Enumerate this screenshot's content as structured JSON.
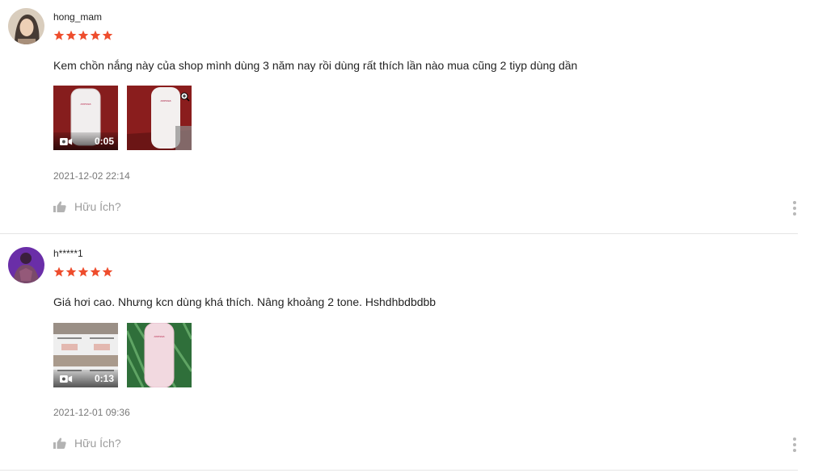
{
  "colors": {
    "star": "#ee4d2d",
    "text": "#222222",
    "muted": "#8a8a8a",
    "divider": "#e5e5e5"
  },
  "reviews": [
    {
      "author": "hong_mam",
      "rating": 5,
      "comment": "Kem chồn nắng này  của shop mình dùng 3 năm nay rồi dùng rất thích lần nào mua cũng 2 tiyp dùng dần",
      "video_duration": "0:05",
      "timestamp": "2021-12-02 22:14",
      "helpful_label": "Hữu Ích?",
      "icons": {
        "video": "video-camera-icon",
        "helpful": "thumbs-up-icon",
        "more": "more-vertical-icon"
      }
    },
    {
      "author": "h*****1",
      "rating": 5,
      "comment": "Giá hơi cao. Nhưng kcn dùng khá thích. Nâng khoảng 2 tone. Hshdhbdbdbb",
      "video_duration": "0:13",
      "timestamp": "2021-12-01 09:36",
      "helpful_label": "Hữu Ích?",
      "icons": {
        "video": "video-camera-icon",
        "helpful": "thumbs-up-icon",
        "more": "more-vertical-icon"
      }
    }
  ]
}
